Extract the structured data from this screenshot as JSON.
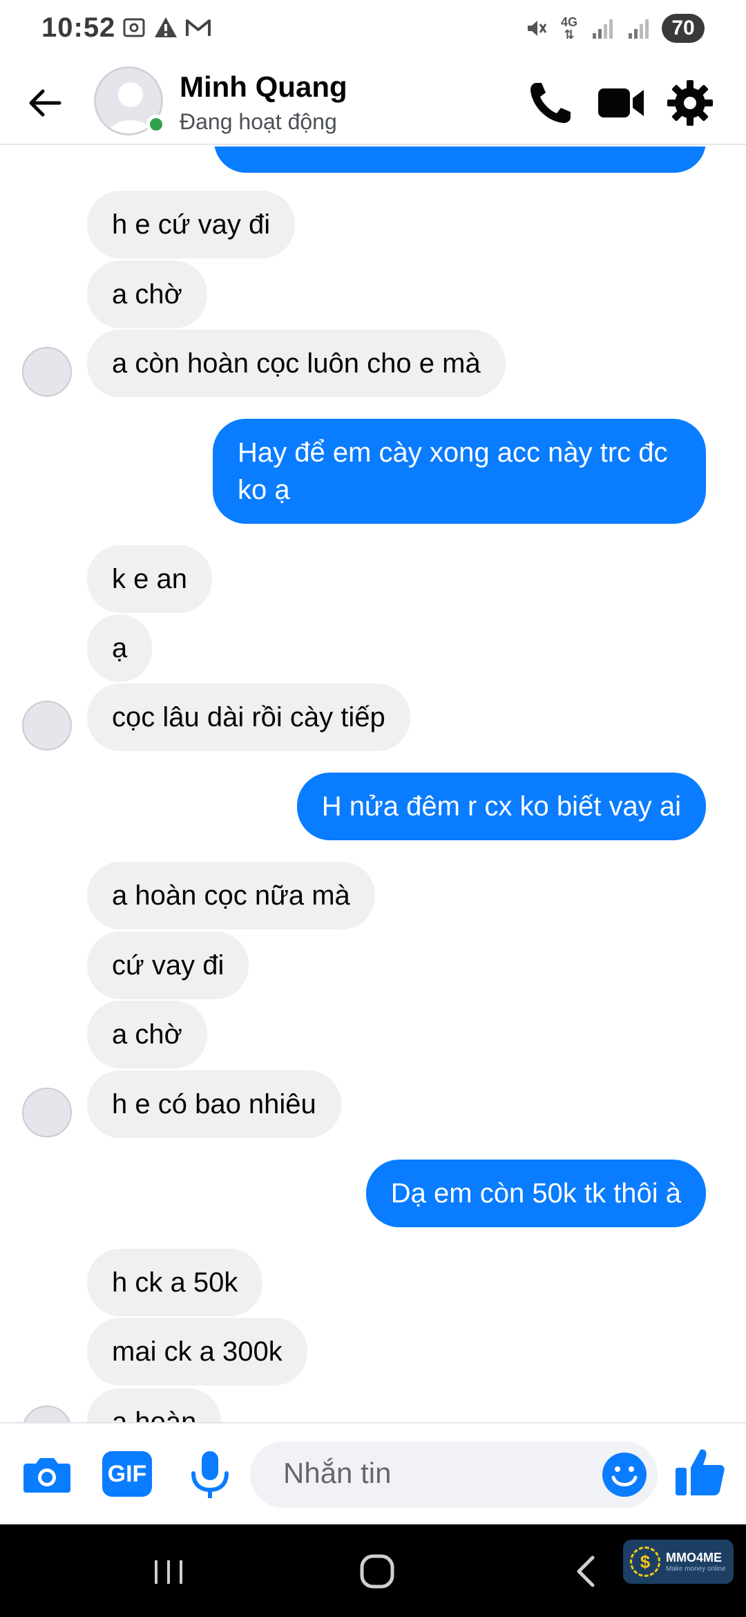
{
  "status_bar": {
    "time": "10:52",
    "network": "4G",
    "battery": "70",
    "left_icons": [
      "screenshot-icon",
      "warning-icon",
      "gmail-icon"
    ],
    "right_icons": [
      "mute-icon",
      "signal-icon",
      "signal-icon"
    ]
  },
  "header": {
    "name": "Minh Quang",
    "status": "Đang hoạt động",
    "online_color": "#31a24c"
  },
  "messages": [
    {
      "dir": "in",
      "text": "h e cứ vay đi"
    },
    {
      "dir": "in",
      "text": "a chờ"
    },
    {
      "dir": "in",
      "text": "a còn hoàn cọc luôn cho e mà"
    },
    {
      "dir": "out",
      "text": "Hay để em cày xong acc này trc đc ko ạ"
    },
    {
      "dir": "in",
      "text": "k e an"
    },
    {
      "dir": "in",
      "text": "ạ"
    },
    {
      "dir": "in",
      "text": "cọc lâu dài rồi cày tiếp"
    },
    {
      "dir": "out",
      "text": "H nửa đêm r cx ko biết vay ai"
    },
    {
      "dir": "in",
      "text": "a hoàn cọc nữa mà"
    },
    {
      "dir": "in",
      "text": "cứ vay đi"
    },
    {
      "dir": "in",
      "text": "a chờ"
    },
    {
      "dir": "in",
      "text": "h e có bao nhiêu"
    },
    {
      "dir": "out",
      "text": "Dạ em còn 50k tk thôi à"
    },
    {
      "dir": "in",
      "text": "h ck a 50k"
    },
    {
      "dir": "in",
      "text": "mai ck a 300k"
    },
    {
      "dir": "in",
      "text": "a hoàn"
    }
  ],
  "composer": {
    "placeholder": "Nhắn tin",
    "gif_label": "GIF"
  },
  "watermark": {
    "title": "MMO4ME",
    "subtitle": "Make money online"
  },
  "colors": {
    "accent": "#0a7cff",
    "incoming_bubble": "#f0f0f0"
  }
}
